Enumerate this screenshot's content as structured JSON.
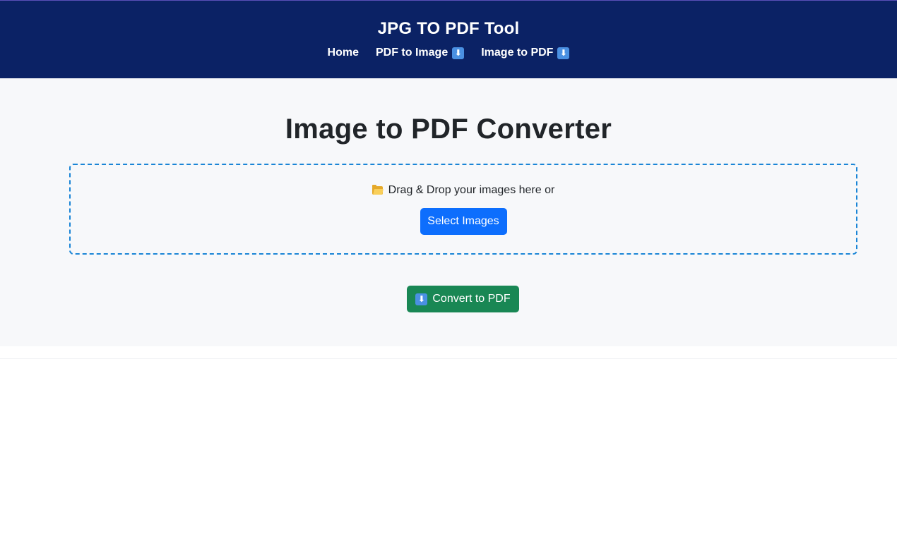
{
  "header": {
    "title": "JPG TO PDF Tool",
    "nav": [
      {
        "label": "Home",
        "icon": null
      },
      {
        "label": "PDF to Image",
        "icon": "down-arrow-icon"
      },
      {
        "label": "Image to PDF",
        "icon": "down-arrow-icon"
      }
    ]
  },
  "main": {
    "title": "Image to PDF Converter",
    "dropzone": {
      "icon": "folder-icon",
      "text": "Drag & Drop your images here or",
      "button_label": "Select Images"
    },
    "convert_button": {
      "icon": "down-arrow-icon",
      "label": "Convert to PDF"
    }
  },
  "colors": {
    "navbar_bg": "#0b2265",
    "main_bg": "#f7f8fa",
    "primary": "#0d6efd",
    "success": "#198754",
    "dropzone_border": "#1a85d6",
    "arrow_icon_bg": "#4a90e2"
  },
  "glyphs": {
    "down_arrow": "⬇"
  }
}
